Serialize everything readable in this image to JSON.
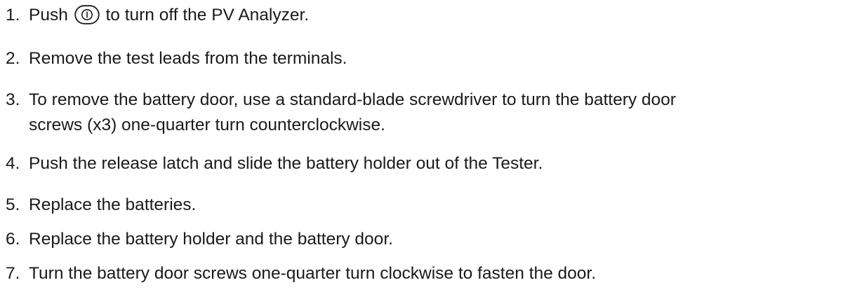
{
  "steps": [
    {
      "number": "1.",
      "before_icon": "Push",
      "icon": "power-button-icon",
      "after_icon": "to turn off the PV Analyzer."
    },
    {
      "number": "2.",
      "text": "Remove the test leads from the terminals."
    },
    {
      "number": "3.",
      "line1": "To remove the battery door, use a standard-blade screwdriver to turn the battery door",
      "line2": "screws (x3) one-quarter turn counterclockwise."
    },
    {
      "number": "4.",
      "text": "Push the release latch and slide the battery holder out of the Tester."
    },
    {
      "number": "5.",
      "text": "Replace the batteries."
    },
    {
      "number": "6.",
      "text": "Replace the battery holder and the battery door."
    },
    {
      "number": "7.",
      "text": "Turn the battery door screws one-quarter turn clockwise to fasten the door."
    }
  ]
}
